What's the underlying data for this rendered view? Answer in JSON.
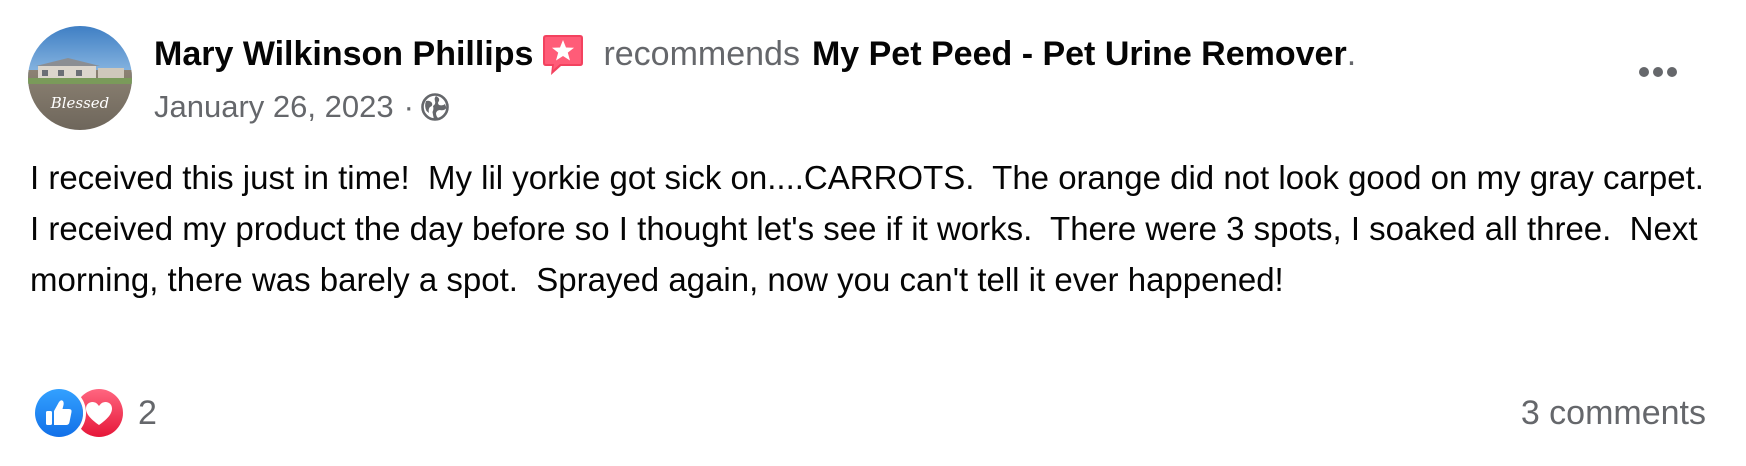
{
  "post": {
    "author": "Mary Wilkinson Phillips",
    "recommends_text": "recommends",
    "page_name": "My Pet Peed - Pet Urine Remover",
    "period": ".",
    "date": "January 26, 2023",
    "meta_separator": "·",
    "privacy_icon": "globe-icon",
    "recommend_icon": "star-badge-icon",
    "more_icon": "more-horizontal-icon",
    "avatar_caption": "Blessed",
    "body": "I received this just in time!  My lil yorkie got sick on....CARROTS.  The orange did not look good on my gray carpet.  I received my product the day before so I thought let's see if it works.  There were 3 spots, I soaked all three.  Next morning, there was barely a spot.  Sprayed again, now you can't tell it ever happened!"
  },
  "footer": {
    "reaction_icons": [
      "like-icon",
      "love-icon"
    ],
    "reaction_count": "2",
    "comments": "3 comments"
  },
  "colors": {
    "text_primary": "#050505",
    "text_secondary": "#65676b",
    "like_blue": "#1877f2",
    "love_red": "#f33e58",
    "recommend_pink": "#f3425f"
  }
}
